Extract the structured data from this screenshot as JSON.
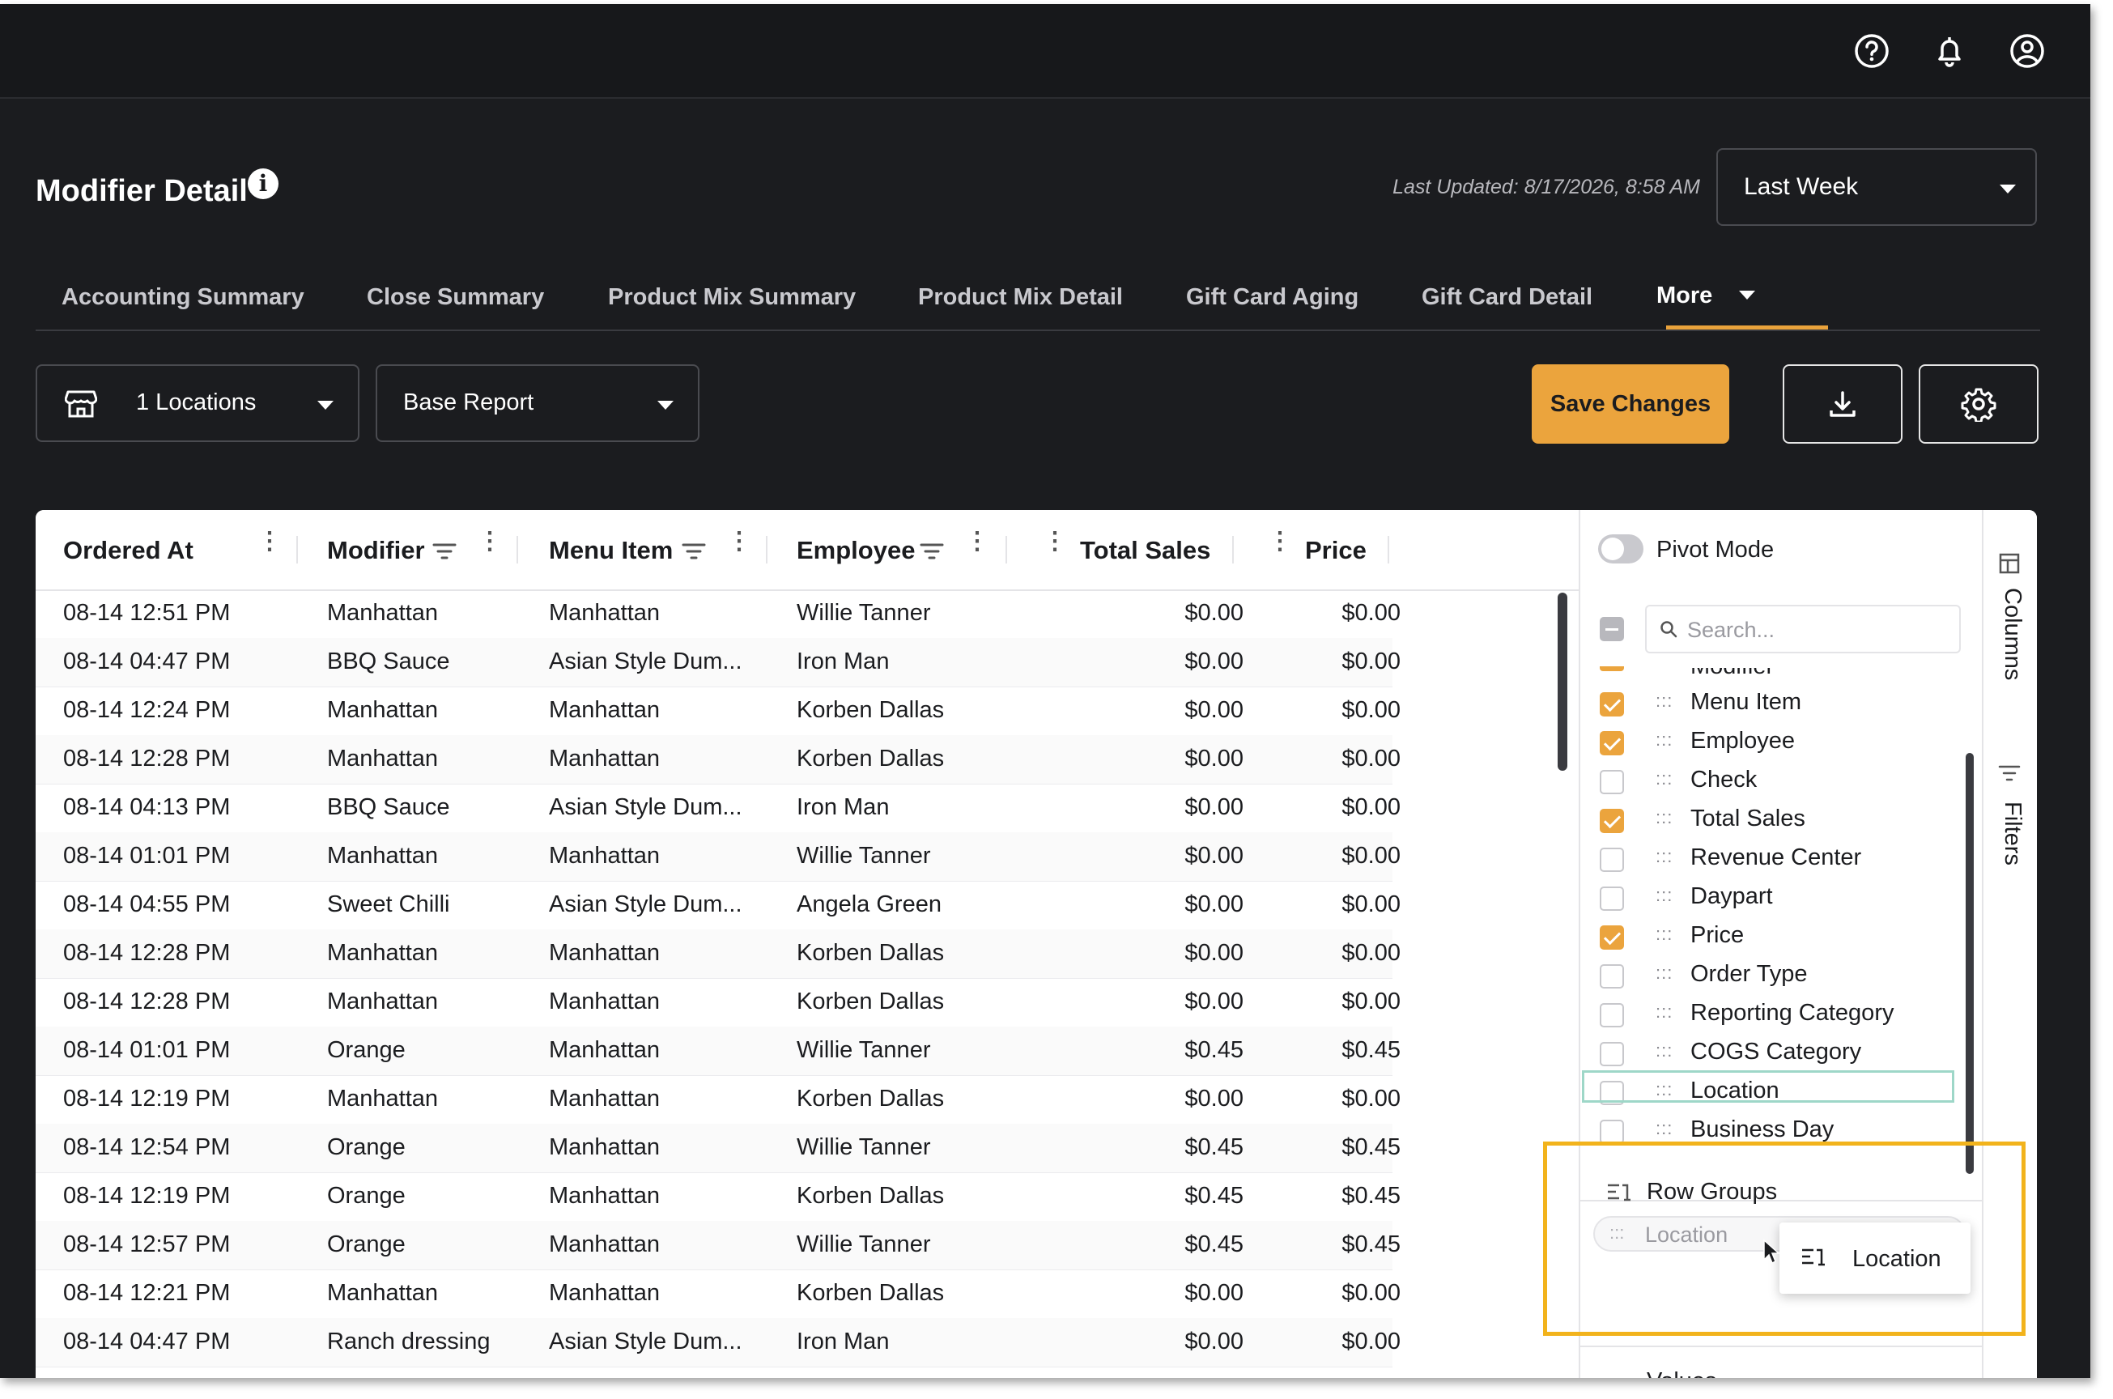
{
  "header": {
    "icons": [
      "help-icon",
      "bell-icon",
      "user-circle-icon"
    ]
  },
  "page": {
    "title": "Modifier Detail",
    "last_updated": "Last Updated: 8/17/2026, 8:58 AM",
    "period": "Last Week"
  },
  "tabs": [
    {
      "label": "Accounting Summary",
      "active": false
    },
    {
      "label": "Close Summary",
      "active": false
    },
    {
      "label": "Product Mix Summary",
      "active": false
    },
    {
      "label": "Product Mix Detail",
      "active": false
    },
    {
      "label": "Gift Card Aging",
      "active": false
    },
    {
      "label": "Gift Card Detail",
      "active": false
    },
    {
      "label": "More",
      "active": true
    }
  ],
  "toolbar": {
    "locations": "1 Locations",
    "report": "Base Report",
    "save_label": "Save Changes"
  },
  "colors": {
    "accent": "#eba43d",
    "background": "#1b1c1f",
    "highlight": "#f2b31c"
  },
  "table": {
    "columns": [
      "Ordered At",
      "Modifier",
      "Menu Item",
      "Employee",
      "Total Sales",
      "Price"
    ],
    "rows": [
      [
        "08-14 12:51 PM",
        "Manhattan",
        "Manhattan",
        "Willie Tanner",
        "$0.00",
        "$0.00"
      ],
      [
        "08-14 04:47 PM",
        "BBQ Sauce",
        "Asian Style Dum...",
        "Iron Man",
        "$0.00",
        "$0.00"
      ],
      [
        "08-14 12:24 PM",
        "Manhattan",
        "Manhattan",
        "Korben Dallas",
        "$0.00",
        "$0.00"
      ],
      [
        "08-14 12:28 PM",
        "Manhattan",
        "Manhattan",
        "Korben Dallas",
        "$0.00",
        "$0.00"
      ],
      [
        "08-14 04:13 PM",
        "BBQ Sauce",
        "Asian Style Dum...",
        "Iron Man",
        "$0.00",
        "$0.00"
      ],
      [
        "08-14 01:01 PM",
        "Manhattan",
        "Manhattan",
        "Willie Tanner",
        "$0.00",
        "$0.00"
      ],
      [
        "08-14 04:55 PM",
        "Sweet Chilli",
        "Asian Style Dum...",
        "Angela Green",
        "$0.00",
        "$0.00"
      ],
      [
        "08-14 12:28 PM",
        "Manhattan",
        "Manhattan",
        "Korben Dallas",
        "$0.00",
        "$0.00"
      ],
      [
        "08-14 12:28 PM",
        "Manhattan",
        "Manhattan",
        "Korben Dallas",
        "$0.00",
        "$0.00"
      ],
      [
        "08-14 01:01 PM",
        "Orange",
        "Manhattan",
        "Willie Tanner",
        "$0.45",
        "$0.45"
      ],
      [
        "08-14 12:19 PM",
        "Manhattan",
        "Manhattan",
        "Korben Dallas",
        "$0.00",
        "$0.00"
      ],
      [
        "08-14 12:54 PM",
        "Orange",
        "Manhattan",
        "Willie Tanner",
        "$0.45",
        "$0.45"
      ],
      [
        "08-14 12:19 PM",
        "Orange",
        "Manhattan",
        "Korben Dallas",
        "$0.45",
        "$0.45"
      ],
      [
        "08-14 12:57 PM",
        "Orange",
        "Manhattan",
        "Willie Tanner",
        "$0.45",
        "$0.45"
      ],
      [
        "08-14 12:21 PM",
        "Manhattan",
        "Manhattan",
        "Korben Dallas",
        "$0.00",
        "$0.00"
      ],
      [
        "08-14 04:47 PM",
        "Ranch dressing",
        "Asian Style Dum...",
        "Iron Man",
        "$0.00",
        "$0.00"
      ]
    ]
  },
  "sidebar": {
    "pivot_mode_label": "Pivot Mode",
    "search_placeholder": "Search...",
    "partial_item": "Modifier",
    "columns": [
      {
        "label": "Menu Item",
        "checked": true
      },
      {
        "label": "Employee",
        "checked": true
      },
      {
        "label": "Check",
        "checked": false
      },
      {
        "label": "Total Sales",
        "checked": true
      },
      {
        "label": "Revenue Center",
        "checked": false
      },
      {
        "label": "Daypart",
        "checked": false
      },
      {
        "label": "Price",
        "checked": true
      },
      {
        "label": "Order Type",
        "checked": false
      },
      {
        "label": "Reporting Category",
        "checked": false
      },
      {
        "label": "COGS Category",
        "checked": false
      },
      {
        "label": "Location",
        "checked": false
      },
      {
        "label": "Business Day",
        "checked": false
      }
    ],
    "row_groups_label": "Row Groups",
    "row_group_chip": "Location",
    "drag_ghost_label": "Location",
    "values_label": "Values",
    "side_tabs": [
      "Columns",
      "Filters"
    ]
  }
}
